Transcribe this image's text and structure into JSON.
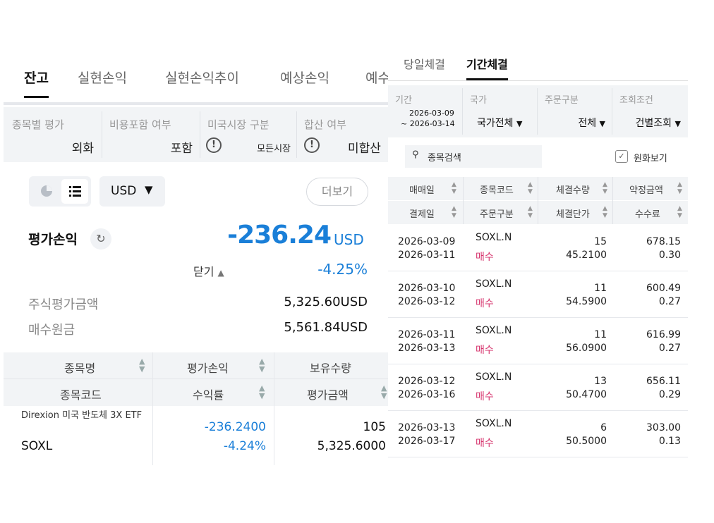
{
  "left_panel": {
    "tabs": [
      "잔고",
      "실현손익",
      "실현손익추이",
      "예상손익",
      "예수"
    ],
    "filters": {
      "eval_by_stock": {
        "label": "종목별 평가",
        "value": "외화"
      },
      "fee_included": {
        "label": "비용포함 여부",
        "value": "포함"
      },
      "us_market": {
        "label": "미국시장 구분",
        "value": "모든시장"
      },
      "combined": {
        "label": "합산 여부",
        "value": "미합산"
      }
    },
    "currency": "USD",
    "more_label": "더보기",
    "pnl": {
      "title": "평가손익",
      "value": "-236.24",
      "unit": "USD",
      "collapse_label": "닫기",
      "rate": "-4.25%"
    },
    "stock_eval": {
      "label": "주식평가금액",
      "value": "5,325.60USD"
    },
    "purchase_cost": {
      "label": "매수원금",
      "value": "5,561.84USD"
    },
    "grid": {
      "header1": [
        "종목명",
        "평가손익",
        "보유수량"
      ],
      "header2": [
        "종목코드",
        "수익률",
        "평가금액"
      ],
      "rows": [
        {
          "name": "Direxion 미국 반도체 3X ETF",
          "code": "SOXL",
          "pnl": "-236.2400",
          "rate": "-4.24%",
          "qty": "105",
          "eval_amount": "5,325.6000"
        }
      ]
    },
    "colors": {
      "accent_blue": "#1a7fd8",
      "buy_red": "#d6336c"
    }
  },
  "right_panel": {
    "tabs": [
      "당일체결",
      "기간체결"
    ],
    "filters": {
      "period": {
        "label": "기간",
        "value1": "2026-03-09",
        "value2": "~ 2026-03-14"
      },
      "country": {
        "label": "국가",
        "value": "국가전체"
      },
      "order_type": {
        "label": "주문구분",
        "value": "전체"
      },
      "query_cond": {
        "label": "조회조건",
        "value": "건별조회"
      }
    },
    "search_placeholder": "종목검색",
    "krw_view_label": "원화보기",
    "header1": [
      "매매일",
      "종목코드",
      "체결수량",
      "약정금액"
    ],
    "header2": [
      "결제일",
      "주문구분",
      "체결단가",
      "수수료"
    ],
    "rows": [
      {
        "trade_date": "2026-03-09",
        "settle_date": "2026-03-11",
        "code": "SOXL.N",
        "side": "매수",
        "qty": "15",
        "price": "45.2100",
        "amount": "678.15",
        "fee": "0.30"
      },
      {
        "trade_date": "2026-03-10",
        "settle_date": "2026-03-12",
        "code": "SOXL.N",
        "side": "매수",
        "qty": "11",
        "price": "54.5900",
        "amount": "600.49",
        "fee": "0.27"
      },
      {
        "trade_date": "2026-03-11",
        "settle_date": "2026-03-13",
        "code": "SOXL.N",
        "side": "매수",
        "qty": "11",
        "price": "56.0900",
        "amount": "616.99",
        "fee": "0.27"
      },
      {
        "trade_date": "2026-03-12",
        "settle_date": "2026-03-16",
        "code": "SOXL.N",
        "side": "매수",
        "qty": "13",
        "price": "50.4700",
        "amount": "656.11",
        "fee": "0.29"
      },
      {
        "trade_date": "2026-03-13",
        "settle_date": "2026-03-17",
        "code": "SOXL.N",
        "side": "매수",
        "qty": "6",
        "price": "50.5000",
        "amount": "303.00",
        "fee": "0.13"
      }
    ]
  }
}
